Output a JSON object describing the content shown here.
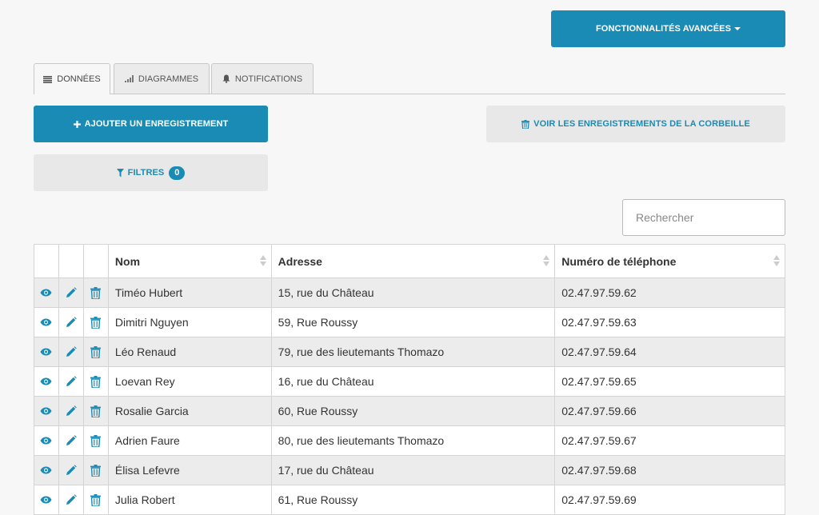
{
  "toolbar": {
    "advanced_label": "Fonctionnalités avancées"
  },
  "tabs": [
    {
      "label": "Données",
      "icon": "list-icon",
      "active": true
    },
    {
      "label": "Diagrammes",
      "icon": "bar-chart-icon",
      "active": false
    },
    {
      "label": "Notifications",
      "icon": "bell-icon",
      "active": false
    }
  ],
  "actions": {
    "add_label": "Ajouter un enregistrement",
    "trash_label": "Voir les enregistrements de la corbeille",
    "filters_label": "Filtres",
    "filters_count": "0"
  },
  "search": {
    "placeholder": "Rechercher",
    "value": ""
  },
  "table": {
    "columns": [
      "Nom",
      "Adresse",
      "Numéro de téléphone"
    ],
    "rows": [
      [
        "Timéo Hubert",
        "15, rue du Château",
        "02.47.97.59.62"
      ],
      [
        "Dimitri Nguyen",
        "59, Rue Roussy",
        "02.47.97.59.63"
      ],
      [
        "Léo Renaud",
        "79, rue des lieutemants Thomazo",
        "02.47.97.59.64"
      ],
      [
        "Loevan Rey",
        "16, rue du Château",
        "02.47.97.59.65"
      ],
      [
        "Rosalie Garcia",
        "60, Rue Roussy",
        "02.47.97.59.66"
      ],
      [
        "Adrien Faure",
        "80, rue des lieutemants Thomazo",
        "02.47.97.59.67"
      ],
      [
        "Élisa Lefevre",
        "17, rue du Château",
        "02.47.97.59.68"
      ],
      [
        "Julia Robert",
        "61, Rue Roussy",
        "02.47.97.59.69"
      ]
    ]
  },
  "colors": {
    "accent": "#1a8bb5",
    "row_alt": "#ececec"
  }
}
